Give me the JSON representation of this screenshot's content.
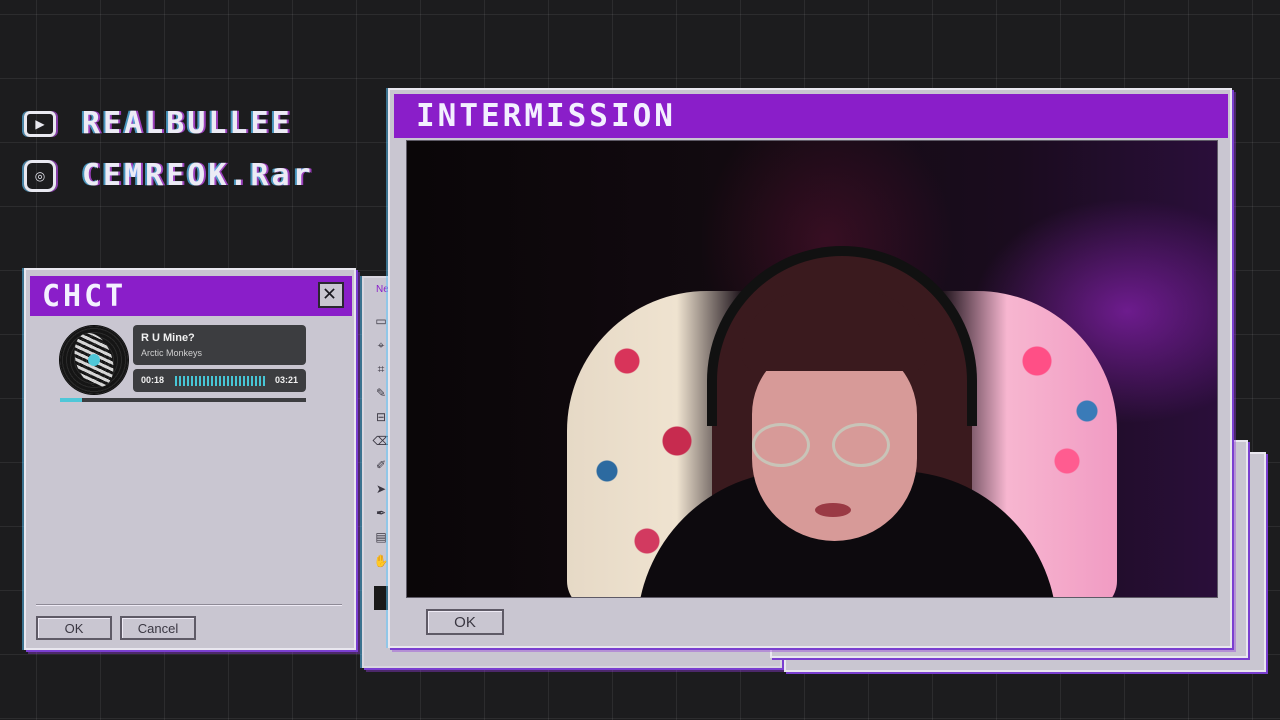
{
  "socials": {
    "youtube": {
      "icon": "youtube-icon",
      "handle": "REALBULLEE"
    },
    "instagram": {
      "icon": "instagram-icon",
      "handle": "CEMREOK.Rar"
    }
  },
  "chat_window": {
    "title": "CHCT",
    "close_glyph": "✕",
    "ok_label": "OK",
    "cancel_label": "Cancel"
  },
  "music": {
    "song": "R U Mine?",
    "artist": "Arctic Monkeys",
    "elapsed": "00:18",
    "duration": "03:21",
    "progress": 0.09
  },
  "tool_window": {
    "label": "Ne",
    "tools": [
      "▭",
      "⌖",
      "⌗",
      "✎",
      "⊟",
      "⌫",
      "✐",
      "➤",
      "✒",
      "▤",
      "✋"
    ]
  },
  "main_window": {
    "title": "INTERMISSION",
    "ok_label": "OK"
  },
  "colors": {
    "accent": "#8a1ec9",
    "window_bg": "#c9c6d1",
    "music_accent": "#4fc7d8"
  }
}
